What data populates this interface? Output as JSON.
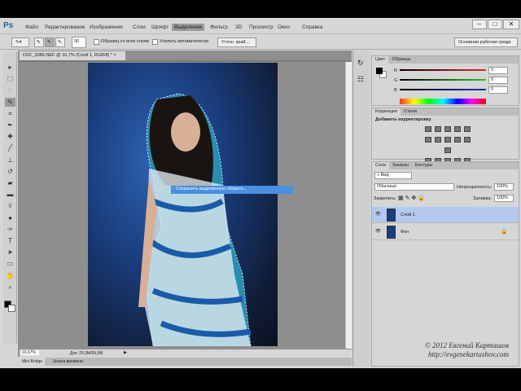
{
  "app": {
    "logo": "Ps"
  },
  "menu": [
    "Файл",
    "Редактирование",
    "Изображение",
    "Слои",
    "Шрифт",
    "Выделение",
    "Фильтр",
    "3D",
    "Просмотр",
    "Окно",
    "Справка"
  ],
  "menu_active": "Выделение",
  "window_controls": {
    "minimize": "–",
    "maximize": "□",
    "close": "✕"
  },
  "options": {
    "brush_size": "30",
    "sample_all": "Образец со всех слоев",
    "auto_enhance": "Усилить автоматически",
    "refine_edge": "Уточн. край..."
  },
  "workspace": "Основная рабочая среда",
  "document": {
    "tab": "DSC_9386.NEF @ 16,7% (Слой 1, RGB/8) *",
    "close": "×",
    "zoom": "16,67%",
    "doc_info": "Док: 29,3M/59,9M"
  },
  "context_menu": {
    "item": "Сохранить выделенную область..."
  },
  "bottom_tabs": [
    "Mini Bridge",
    "Шкала времени"
  ],
  "color_panel": {
    "tabs": [
      "Цвет",
      "Образцы"
    ],
    "channels": [
      {
        "label": "R",
        "value": "0",
        "color": "#d83030"
      },
      {
        "label": "G",
        "value": "0",
        "color": "#30c030"
      },
      {
        "label": "B",
        "value": "0",
        "color": "#2030c0"
      }
    ]
  },
  "adjust_panel": {
    "tabs": [
      "Коррекция",
      "Стили"
    ],
    "title": "Добавить корректировку"
  },
  "layers_panel": {
    "tabs": [
      "Слои",
      "Каналы",
      "Контуры"
    ],
    "filter": "Вид",
    "blend": "Обычные",
    "opacity_label": "Непрозрачность:",
    "opacity": "100%",
    "lock_label": "Закрепить:",
    "fill_label": "Заливка:",
    "fill": "100%",
    "layers": [
      {
        "name": "Слой 1",
        "selected": true
      },
      {
        "name": "Фон",
        "locked": true
      }
    ]
  },
  "watermark": {
    "line1": "© 2012 Евгений Карташов",
    "line2": "http://evgenekartashov.com"
  }
}
